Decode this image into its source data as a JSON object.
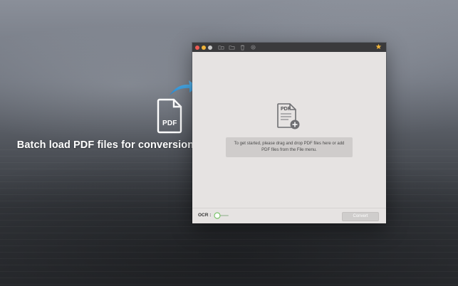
{
  "promo": {
    "caption": "Batch load PDF files for conversion",
    "doc_badge": "PDF"
  },
  "window": {
    "toolbar_icons": [
      "folder-add-icon",
      "folder-open-icon",
      "trash-icon",
      "settings-icon"
    ],
    "star_icon": "star-icon",
    "drop_icon_label": "PDF",
    "hint": "To get started, please drag and drop PDF files here or add PDF files from the File menu.",
    "ocr_label": "OCR :",
    "ocr_toggle_on": false,
    "convert_label": "Convert"
  },
  "colors": {
    "accent_star": "#f2b53a",
    "toggle_green": "#7cc36b",
    "promo_arrow": "#38a7e6"
  }
}
